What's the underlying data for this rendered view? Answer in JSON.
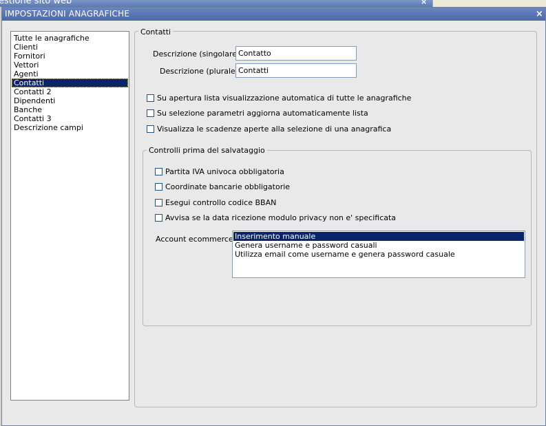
{
  "background_window": {
    "title": "estione sito web",
    "close_glyph": "×"
  },
  "dialog": {
    "title": "IMPOSTAZIONI ANAGRAFICHE",
    "close_glyph": "×"
  },
  "nav": {
    "items": [
      "Tutte le anagrafiche",
      "Clienti",
      "Fornitori",
      "Vettori",
      "Agenti",
      "Contatti",
      "Contatti 2",
      "Dipendenti",
      "Banche",
      "Contatti 3",
      "Descrizione campi"
    ],
    "selected_index": 5
  },
  "contatti": {
    "legend": "Contatti",
    "singular_label": "Descrizione (singolare) :",
    "singular_value": "Contatto",
    "plural_label": "Descrizione (plurale) :",
    "plural_value": "Contatti",
    "options": [
      {
        "label": "Su apertura lista visualizzazione automatica di tutte le anagrafiche",
        "checked": false
      },
      {
        "label": "Su selezione parametri aggiorna automaticamente lista",
        "checked": false
      },
      {
        "label": "Visualizza le scadenze aperte alla selezione di una anagrafica",
        "checked": false
      }
    ]
  },
  "controlli": {
    "legend": "Controlli prima del salvataggio",
    "options": [
      {
        "label": "Partita IVA univoca obbligatoria",
        "checked": false
      },
      {
        "label": "Coordinate bancarie obbligatorie",
        "checked": false
      },
      {
        "label": "Esegui controllo codice BBAN",
        "checked": false
      },
      {
        "label": "Avvisa se la data ricezione modulo privacy non e' specificata",
        "checked": false
      }
    ],
    "account_label": "Account ecommerce :",
    "account_options": [
      "Inserimento manuale",
      "Genera username e password casuali",
      "Utilizza email come username e genera password casuale"
    ],
    "account_selected_index": 0
  },
  "colors": {
    "selection": "#0a246a",
    "titlebar": "#5a76b3",
    "dialog_bg": "#e9e9e9"
  }
}
